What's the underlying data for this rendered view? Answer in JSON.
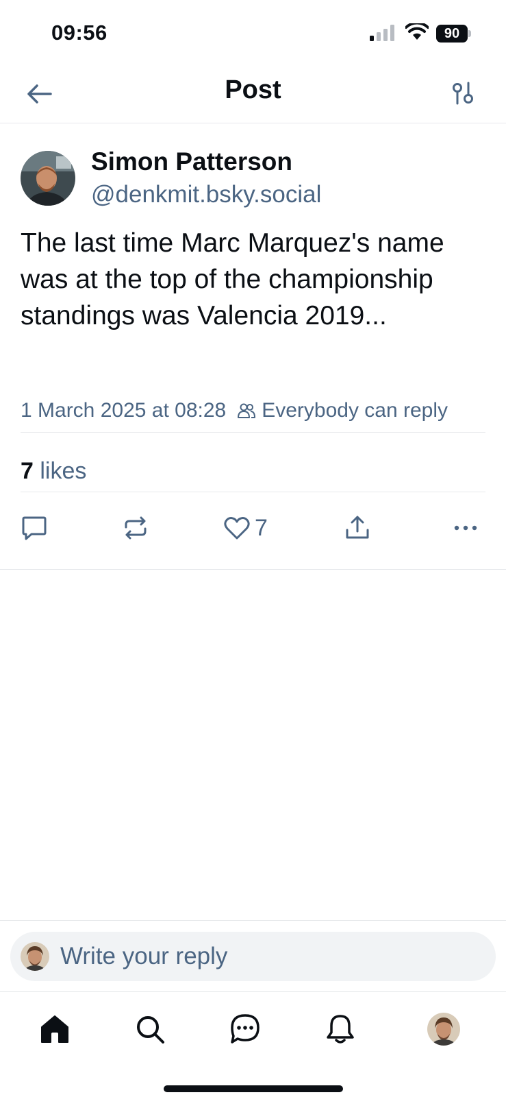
{
  "status_bar": {
    "time": "09:56",
    "battery": "90",
    "icons": [
      "signal-icon",
      "wifi-icon",
      "battery-icon"
    ]
  },
  "header": {
    "title": "Post",
    "back_icon": "arrow-left-icon",
    "filter_icon": "sliders-icon"
  },
  "post": {
    "author_name": "Simon Patterson",
    "author_handle": "@denkmit.bsky.social",
    "text": "The last time Marc Marquez's name was at the top of the championship standings was Valencia 2019...",
    "timestamp": "1 March 2025 at 08:28",
    "reply_setting": "Everybody can reply",
    "likes_count": "7",
    "likes_label": "likes",
    "actions": {
      "reply_icon": "comment-icon",
      "repost_icon": "repost-icon",
      "like_icon": "heart-icon",
      "like_count": "7",
      "share_icon": "share-icon",
      "more_icon": "more-icon"
    }
  },
  "reply_bar": {
    "placeholder": "Write your reply"
  },
  "bottom_nav": {
    "items": [
      "home-icon",
      "search-icon",
      "chat-icon",
      "bell-icon",
      "profile-avatar"
    ]
  },
  "colors": {
    "text_primary": "#0b0f14",
    "text_secondary": "#4b6583",
    "divider": "#e6e8eb",
    "input_bg": "#f1f3f5"
  }
}
